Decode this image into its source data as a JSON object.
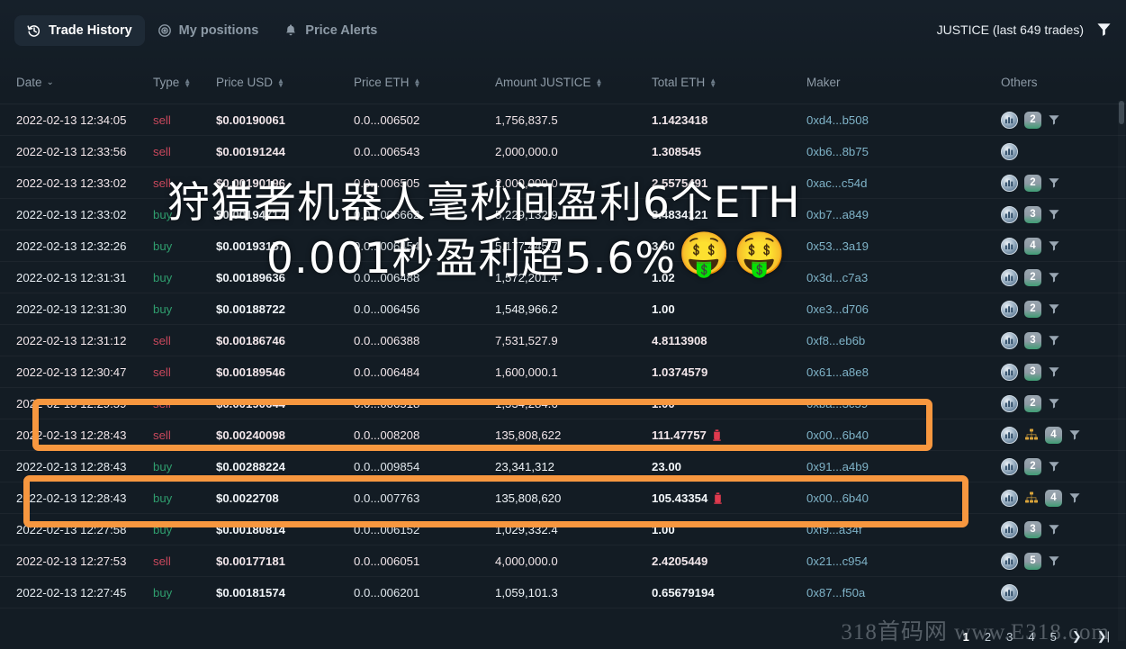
{
  "tabs": [
    {
      "id": "trade-history",
      "label": "Trade History",
      "icon": "history-icon",
      "active": true
    },
    {
      "id": "my-positions",
      "label": "My positions",
      "icon": "target-icon",
      "active": false
    },
    {
      "id": "price-alerts",
      "label": "Price Alerts",
      "icon": "bell-icon",
      "active": false
    }
  ],
  "header": {
    "pair_label": "JUSTICE (last 649 trades)",
    "filter_icon": "filter-funnel-icon"
  },
  "columns": [
    {
      "key": "date",
      "label": "Date",
      "sort": "chevron-down-icon"
    },
    {
      "key": "type",
      "label": "Type",
      "sort": "sort-updown-icon"
    },
    {
      "key": "price",
      "label": "Price USD",
      "sort": "sort-updown-icon"
    },
    {
      "key": "peth",
      "label": "Price ETH",
      "sort": "sort-updown-icon"
    },
    {
      "key": "amt",
      "label": "Amount JUSTICE",
      "sort": "sort-updown-icon"
    },
    {
      "key": "teth",
      "label": "Total ETH",
      "sort": "sort-updown-icon"
    },
    {
      "key": "maker",
      "label": "Maker",
      "sort": ""
    },
    {
      "key": "oth",
      "label": "Others",
      "sort": ""
    }
  ],
  "rows": [
    {
      "date": "2022-02-13 12:34:05",
      "type": "sell",
      "price": "$0.00190061",
      "peth": "0.0...006502",
      "amt": "1,756,837.5",
      "teth": "1.1423418",
      "alert": false,
      "maker": "0xd4...b508",
      "chart": true,
      "sitemap": false,
      "count": "2",
      "funnel": true,
      "highlight": false
    },
    {
      "date": "2022-02-13 12:33:56",
      "type": "sell",
      "price": "$0.00191244",
      "peth": "0.0...006543",
      "amt": "2,000,000.0",
      "teth": "1.308545",
      "alert": false,
      "maker": "0xb6...8b75",
      "chart": true,
      "sitemap": false,
      "count": "",
      "funnel": false,
      "highlight": false
    },
    {
      "date": "2022-02-13 12:33:02",
      "type": "sell",
      "price": "$0.00190196",
      "peth": "0.0...006505",
      "amt": "2,000,000.0",
      "teth": "2.5575491",
      "alert": false,
      "maker": "0xac...c54d",
      "chart": true,
      "sitemap": false,
      "count": "2",
      "funnel": true,
      "highlight": false
    },
    {
      "date": "2022-02-13 12:33:02",
      "type": "buy",
      "price": "$0.00194717",
      "peth": "0.0...006662",
      "amt": "5,229,132.9",
      "teth": "3.4834121",
      "alert": false,
      "maker": "0xb7...a849",
      "chart": true,
      "sitemap": false,
      "count": "3",
      "funnel": true,
      "highlight": false
    },
    {
      "date": "2022-02-13 12:32:26",
      "type": "buy",
      "price": "$0.00193157",
      "peth": "0.0...006454",
      "amt": "5,177,445.7",
      "teth": "3.60",
      "alert": false,
      "maker": "0x53...3a19",
      "chart": true,
      "sitemap": false,
      "count": "4",
      "funnel": true,
      "highlight": false
    },
    {
      "date": "2022-02-13 12:31:31",
      "type": "buy",
      "price": "$0.00189636",
      "peth": "0.0...006488",
      "amt": "1,572,201.4",
      "teth": "1.02",
      "alert": false,
      "maker": "0x3d...c7a3",
      "chart": true,
      "sitemap": false,
      "count": "2",
      "funnel": true,
      "highlight": false
    },
    {
      "date": "2022-02-13 12:31:30",
      "type": "buy",
      "price": "$0.00188722",
      "peth": "0.0...006456",
      "amt": "1,548,966.2",
      "teth": "1.00",
      "alert": false,
      "maker": "0xe3...d706",
      "chart": true,
      "sitemap": false,
      "count": "2",
      "funnel": true,
      "highlight": false
    },
    {
      "date": "2022-02-13 12:31:12",
      "type": "sell",
      "price": "$0.00186746",
      "peth": "0.0...006388",
      "amt": "7,531,527.9",
      "teth": "4.8113908",
      "alert": false,
      "maker": "0xf8...eb6b",
      "chart": true,
      "sitemap": false,
      "count": "3",
      "funnel": true,
      "highlight": false
    },
    {
      "date": "2022-02-13 12:30:47",
      "type": "sell",
      "price": "$0.00189546",
      "peth": "0.0...006484",
      "amt": "1,600,000.1",
      "teth": "1.0374579",
      "alert": false,
      "maker": "0x61...a8e8",
      "chart": true,
      "sitemap": false,
      "count": "3",
      "funnel": true,
      "highlight": false
    },
    {
      "date": "2022-02-13 12:29:59",
      "type": "sell",
      "price": "$0.00190644",
      "peth": "0.0...006518",
      "amt": "1,534,284.6",
      "teth": "1.00",
      "alert": false,
      "maker": "0xba...3c59",
      "chart": true,
      "sitemap": false,
      "count": "2",
      "funnel": true,
      "highlight": true
    },
    {
      "date": "2022-02-13 12:28:43",
      "type": "sell",
      "price": "$0.00240098",
      "peth": "0.0...008208",
      "amt": "135,808,622",
      "teth": "111.47757",
      "alert": true,
      "maker": "0x00...6b40",
      "chart": true,
      "sitemap": true,
      "count": "4",
      "funnel": true,
      "highlight": true
    },
    {
      "date": "2022-02-13 12:28:43",
      "type": "buy",
      "price": "$0.00288224",
      "peth": "0.0...009854",
      "amt": "23,341,312",
      "teth": "23.00",
      "alert": false,
      "maker": "0x91...a4b9",
      "chart": true,
      "sitemap": false,
      "count": "2",
      "funnel": true,
      "highlight": false
    },
    {
      "date": "2022-02-13 12:28:43",
      "type": "buy",
      "price": "$0.0022708",
      "peth": "0.0...007763",
      "amt": "135,808,620",
      "teth": "105.43354",
      "alert": true,
      "maker": "0x00...6b40",
      "chart": true,
      "sitemap": true,
      "count": "4",
      "funnel": true,
      "highlight": true
    },
    {
      "date": "2022-02-13 12:27:58",
      "type": "buy",
      "price": "$0.00180814",
      "peth": "0.0...006152",
      "amt": "1,029,332.4",
      "teth": "1.00",
      "alert": false,
      "maker": "0xf9...a34f",
      "chart": true,
      "sitemap": false,
      "count": "3",
      "funnel": true,
      "highlight": false
    },
    {
      "date": "2022-02-13 12:27:53",
      "type": "sell",
      "price": "$0.00177181",
      "peth": "0.0...006051",
      "amt": "4,000,000.0",
      "teth": "2.4205449",
      "alert": false,
      "maker": "0x21...c954",
      "chart": true,
      "sitemap": false,
      "count": "5",
      "funnel": true,
      "highlight": false
    },
    {
      "date": "2022-02-13 12:27:45",
      "type": "buy",
      "price": "$0.00181574",
      "peth": "0.0...006201",
      "amt": "1,059,101.3",
      "teth": "0.65679194",
      "alert": false,
      "maker": "0x87...f50a",
      "chart": true,
      "sitemap": false,
      "count": "",
      "funnel": false,
      "highlight": false
    }
  ],
  "pagination": {
    "pages": [
      "1",
      "2",
      "3",
      "4",
      "5"
    ],
    "current": "1",
    "next_icon": "chevron-right-icon",
    "last_icon": "skip-to-end-icon"
  },
  "overlay": {
    "line1": "狩猎者机器人毫秒间盈利6个ETH",
    "line2": "0.001秒盈利超5.6%",
    "emoji1": "🤑",
    "emoji2": "🤑"
  },
  "watermark": {
    "text": "318首码网 www.E318.com"
  },
  "colors": {
    "background": "#131c24",
    "accent_highlight": "#f7973f",
    "buy_green": "#2f9e6e",
    "sell_red": "#c8485c",
    "maker_link": "#7fb3c8",
    "badge_green": "#3f9d74"
  }
}
